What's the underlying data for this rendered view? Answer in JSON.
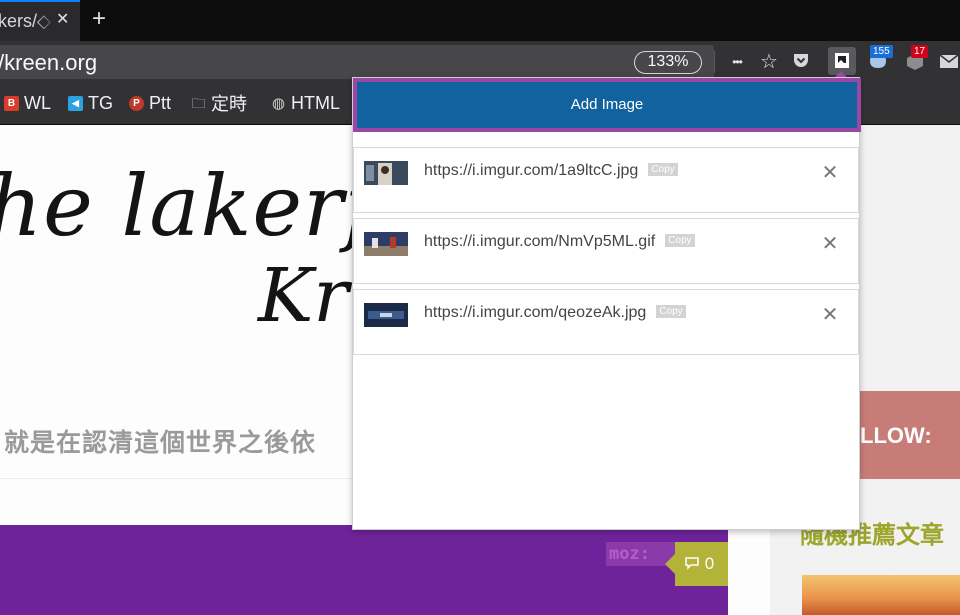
{
  "browser": {
    "tab": {
      "title": "kers/◇",
      "close_glyph": "✕"
    },
    "new_tab_glyph": "+",
    "url": "/kreen.org",
    "zoom": "133%",
    "toolbar": {
      "more_glyph": "•••",
      "star_glyph": "☆",
      "badges": {
        "first": "155",
        "second": "17"
      }
    },
    "bookmarks": [
      {
        "label": "WL",
        "icon": "wl-bookmark-icon",
        "icon_glyph": "B",
        "color": "#d93c2b"
      },
      {
        "label": "TG",
        "icon": "telegram-icon",
        "icon_glyph": "◀",
        "color": "#2aa3e0"
      },
      {
        "label": "Ptt",
        "icon": "ptt-icon",
        "icon_glyph": "P",
        "color": "#c0392b"
      },
      {
        "label": "定時",
        "icon": "folder-icon",
        "icon_glyph": "🗀",
        "color": "#d0d0d0"
      },
      {
        "label": "HTML",
        "icon": "globe-icon",
        "icon_glyph": "◍",
        "color": "#d0d0d0"
      }
    ]
  },
  "page": {
    "hero_line1": "he lakerfr",
    "hero_line2": "Kr",
    "tagline": "就是在認清這個世界之後依",
    "moz_tag": "moz:",
    "comment_count": "0",
    "follow": "LLOW:",
    "recommend": "隨機推薦文章"
  },
  "popup": {
    "add_button": "Add Image",
    "copy_label": "Copy",
    "remove_glyph": "✕",
    "images": [
      {
        "url": "https://i.imgur.com/1a9ltcC.jpg"
      },
      {
        "url": "https://i.imgur.com/NmVp5ML.gif"
      },
      {
        "url": "https://i.imgur.com/qeozeAk.jpg"
      }
    ]
  },
  "colors": {
    "popup_button": "#11629e",
    "popup_button_border": "#9a47a6",
    "purple_bar": "#6f239b",
    "follow_box": "#c87c78",
    "recommend_text": "#9da52b"
  }
}
